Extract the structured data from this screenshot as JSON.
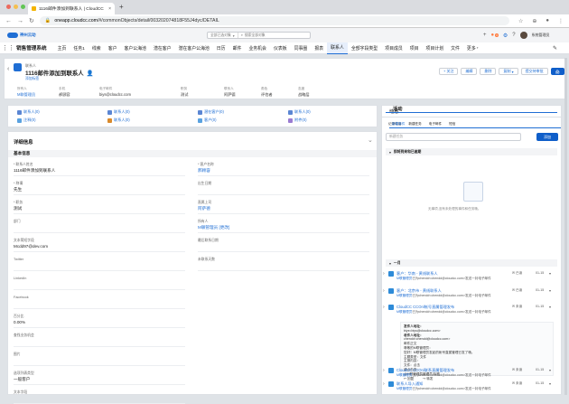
{
  "browser": {
    "tab_title": "1116邮件添加到联系人 | CloudCC",
    "tab_close": "×",
    "new_tab": "+",
    "url_host": "oneapp.cloudcc.com",
    "url_path": "/#/commonObjects/detail/003202074818F55J4dyc/DETAIL",
    "dot_colors": [
      "#ec6a5e",
      "#f4bf4f",
      "#61c554"
    ]
  },
  "app": {
    "brand": "神州云动",
    "app_name": "销售管理系统",
    "search_scope": "全部已选对象",
    "search_placeholder": "搜索全部对象",
    "notify_count": "3",
    "user_name": "系统管理员",
    "nav": [
      {
        "label": "主页",
        "active": false,
        "dd": false
      },
      {
        "label": "任务1",
        "active": false,
        "dd": false
      },
      {
        "label": "线索",
        "active": false,
        "dd": false
      },
      {
        "label": "客户",
        "active": false,
        "dd": false
      },
      {
        "label": "客户公海池",
        "active": false,
        "dd": false
      },
      {
        "label": "潜在客户",
        "active": false,
        "dd": false
      },
      {
        "label": "潜在客户公海池",
        "active": false,
        "dd": false
      },
      {
        "label": "日历",
        "active": false,
        "dd": false
      },
      {
        "label": "邮件",
        "active": false,
        "dd": false
      },
      {
        "label": "业务机会",
        "active": false,
        "dd": false
      },
      {
        "label": "仪表板",
        "active": false,
        "dd": false
      },
      {
        "label": "同事圈",
        "active": false,
        "dd": false
      },
      {
        "label": "报表",
        "active": false,
        "dd": false
      },
      {
        "label": "联系人",
        "active": true,
        "dd": false
      },
      {
        "label": "全部字段类型",
        "active": false,
        "dd": false
      },
      {
        "label": "项目成员",
        "active": false,
        "dd": false
      },
      {
        "label": "项目",
        "active": false,
        "dd": false
      },
      {
        "label": "项目计划",
        "active": false,
        "dd": false
      },
      {
        "label": "文件",
        "active": false,
        "dd": false
      },
      {
        "label": "更多",
        "active": false,
        "dd": true
      }
    ]
  },
  "record": {
    "type": "联系人",
    "title": "1116邮件添加到联系人",
    "subscribe": "添加标签",
    "buttons": {
      "follow": "+ 关注",
      "edit": "编辑",
      "delete": "删除",
      "copy": "复制",
      "share": "提交待审批",
      "print": "🖨"
    },
    "header_fields": [
      {
        "label": "所有人",
        "value": "M联管理员",
        "link": true
      },
      {
        "label": "手机",
        "value": "郝顾容",
        "link": false
      },
      {
        "label": "电子邮件",
        "value": "biys@cloudcc.com",
        "link": false
      },
      {
        "label": "职务",
        "value": "测试",
        "link": false
      },
      {
        "label": "联系人",
        "value": "阿萨德",
        "link": false
      },
      {
        "label": "角色",
        "value": "评估者",
        "link": false
      },
      {
        "label": "态度",
        "value": "战略层",
        "link": false
      }
    ],
    "related": [
      {
        "label": "联系人(0)"
      },
      {
        "label": "注释(0)"
      },
      {
        "label": "联系人(0)"
      },
      {
        "label": "联系人(0)"
      },
      {
        "label": "潜在客户(0)"
      },
      {
        "label": "客户(0)"
      },
      {
        "label": "联系人(0)"
      },
      {
        "label": "附件(0)"
      }
    ]
  },
  "detail": {
    "title": "详细信息",
    "section": "基本信息",
    "left_fields": [
      {
        "label": "* 联系人姓名",
        "value": "1116邮件添加到联系人"
      },
      {
        "label": "* 称谓",
        "value": "先生"
      },
      {
        "label": "* 职务",
        "value": "测试"
      },
      {
        "label": "部门",
        "value": ""
      },
      {
        "label": "文本简短字段",
        "value": "Mcdd97@dev.com"
      },
      {
        "label": "Twitter",
        "value": ""
      },
      {
        "label": "LinkedIn",
        "value": ""
      },
      {
        "label": "Facebook",
        "value": ""
      },
      {
        "label": "百分比",
        "value": "0.00%"
      },
      {
        "label": "查找业务机会",
        "value": ""
      },
      {
        "label": "图片",
        "value": ""
      },
      {
        "label": "选项列表类型",
        "value": "一般客户"
      },
      {
        "label": "文本字段",
        "value": ""
      }
    ],
    "right_fields": [
      {
        "label": "* 客户名称",
        "value": "郝顾容",
        "link": true
      },
      {
        "label": "出生日期",
        "value": "",
        "link": false
      },
      {
        "label": "直属上司",
        "value": "阿萨德",
        "link": true
      },
      {
        "label": "所有人",
        "value": "M联管理员 [更改]",
        "link": true
      },
      {
        "label": "最后联系日期",
        "value": "",
        "link": false
      },
      {
        "label": "未联系天数",
        "value": "",
        "link": false
      }
    ]
  },
  "activity": {
    "tabs": [
      "活动",
      "动态"
    ],
    "subtabs": [
      "新建事件",
      "记录电话",
      "新建任务",
      "电子邮件",
      "短信"
    ],
    "input_placeholder": "新建任务",
    "add_button": "添加",
    "overdue_title": "即将到来和已逾期",
    "empty_text": "无事项,没有未处理的事件和任务哦。",
    "month_title": "一月",
    "items": [
      {
        "title": "客户：华南 - 黄线联系人",
        "sub_user": "M联管理员",
        "sub_text": "已为chendd<chendd@cloudcc.com>发送一封电子邮件",
        "status": "已读",
        "date": "01-15",
        "color": "#2e8bd8"
      },
      {
        "title": "客户：北京市 - 黄线联系人",
        "sub_user": "M联管理员",
        "sub_text": "已为chendd<chendd@cloudcc.com>发送一封电子邮件",
        "status": "已读",
        "date": "01-15",
        "color": "#2e8bd8"
      },
      {
        "title": "CloudCC CCOnl帐号直属管理发布",
        "sub_user": "M联管理员",
        "sub_text": "已为chendd<chendd@cloudcc.com>发送一封电子邮件",
        "status": "未读",
        "date": "01-15",
        "color": "#2e8bd8"
      }
    ],
    "items2": [
      {
        "title": "CloudCC CCOnl联系直属管理发布",
        "sub_user": "M联管理员",
        "sub_text": "已为chendd<chendd@cloudcc.com>发送一封电子邮件",
        "status": "未读",
        "date": "01-15",
        "color": "#2e8bd8"
      },
      {
        "title": "联系人导入通知",
        "sub_user": "M联管理员",
        "sub_text": "已为chendd<chendd@cloudcc.com>发送一封电子邮件",
        "status": "未读",
        "date": "01-15",
        "color": "#2e8bd8"
      }
    ],
    "mail": {
      "from_label": "发件人地址：",
      "from": "biys<biys@cloudcc.com>",
      "to_label": "收件人地址：",
      "to": "chendd<chendd@cloudcc.com>",
      "body1": "邮件正文",
      "body2": "尊敬的M联管理员：",
      "body3": "您好！M联管理员发起的帐号直属管理已发了哦。",
      "body4": "主题类型：文件",
      "body5": "主报内容：",
      "body6": "文件：点击",
      "body7": "请点击查：",
      "body8": "@M联管理员管理员 标签",
      "reply": "回复",
      "forward": "转发"
    }
  }
}
